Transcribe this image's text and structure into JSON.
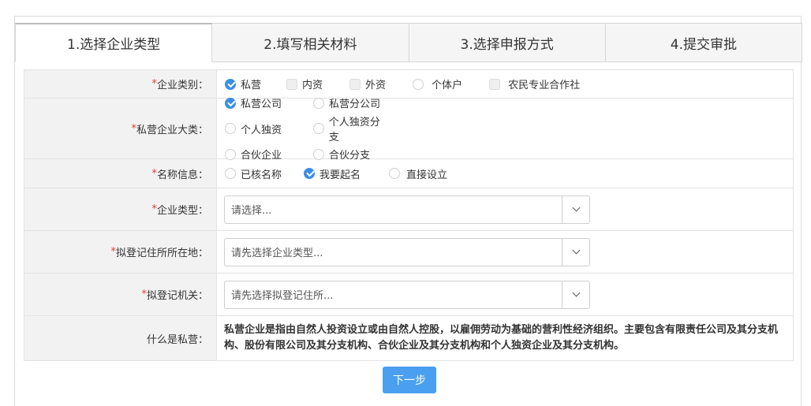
{
  "tabs": [
    {
      "label": "1.选择企业类型"
    },
    {
      "label": "2.填写相关材料"
    },
    {
      "label": "3.选择申报方式"
    },
    {
      "label": "4.提交审批"
    }
  ],
  "form": {
    "enterprise_category": {
      "label": "企业类别：",
      "options": [
        "私营",
        "内资",
        "外资",
        "个体户",
        "农民专业合作社"
      ]
    },
    "private_major": {
      "label": "私营企业大类：",
      "options": [
        "私营公司",
        "私营分公司",
        "个人独资",
        "个人独资分支",
        "合伙企业",
        "合伙分支"
      ]
    },
    "name_info": {
      "label": "名称信息：",
      "options": [
        "已核名称",
        "我要起名",
        "直接设立"
      ]
    },
    "enterprise_type": {
      "label": "企业类型：",
      "placeholder": "请选择..."
    },
    "registered_address": {
      "label": "拟登记住所所在地：",
      "placeholder": "请先选择企业类型..."
    },
    "registration_authority": {
      "label": "拟登记机关：",
      "placeholder": "请先选择拟登记住所..."
    },
    "what_is_private": {
      "label": "什么是私营：",
      "text": "私营企业是指由自然人投资设立或由自然人控股，以雇佣劳动为基础的营利性经济组织。主要包含有限责任公司及其分支机构、股份有限公司及其分支机构、合伙企业及其分支机构和个人独资企业及其分支机构。"
    },
    "required_mark": "*"
  },
  "next_button": "下一步"
}
